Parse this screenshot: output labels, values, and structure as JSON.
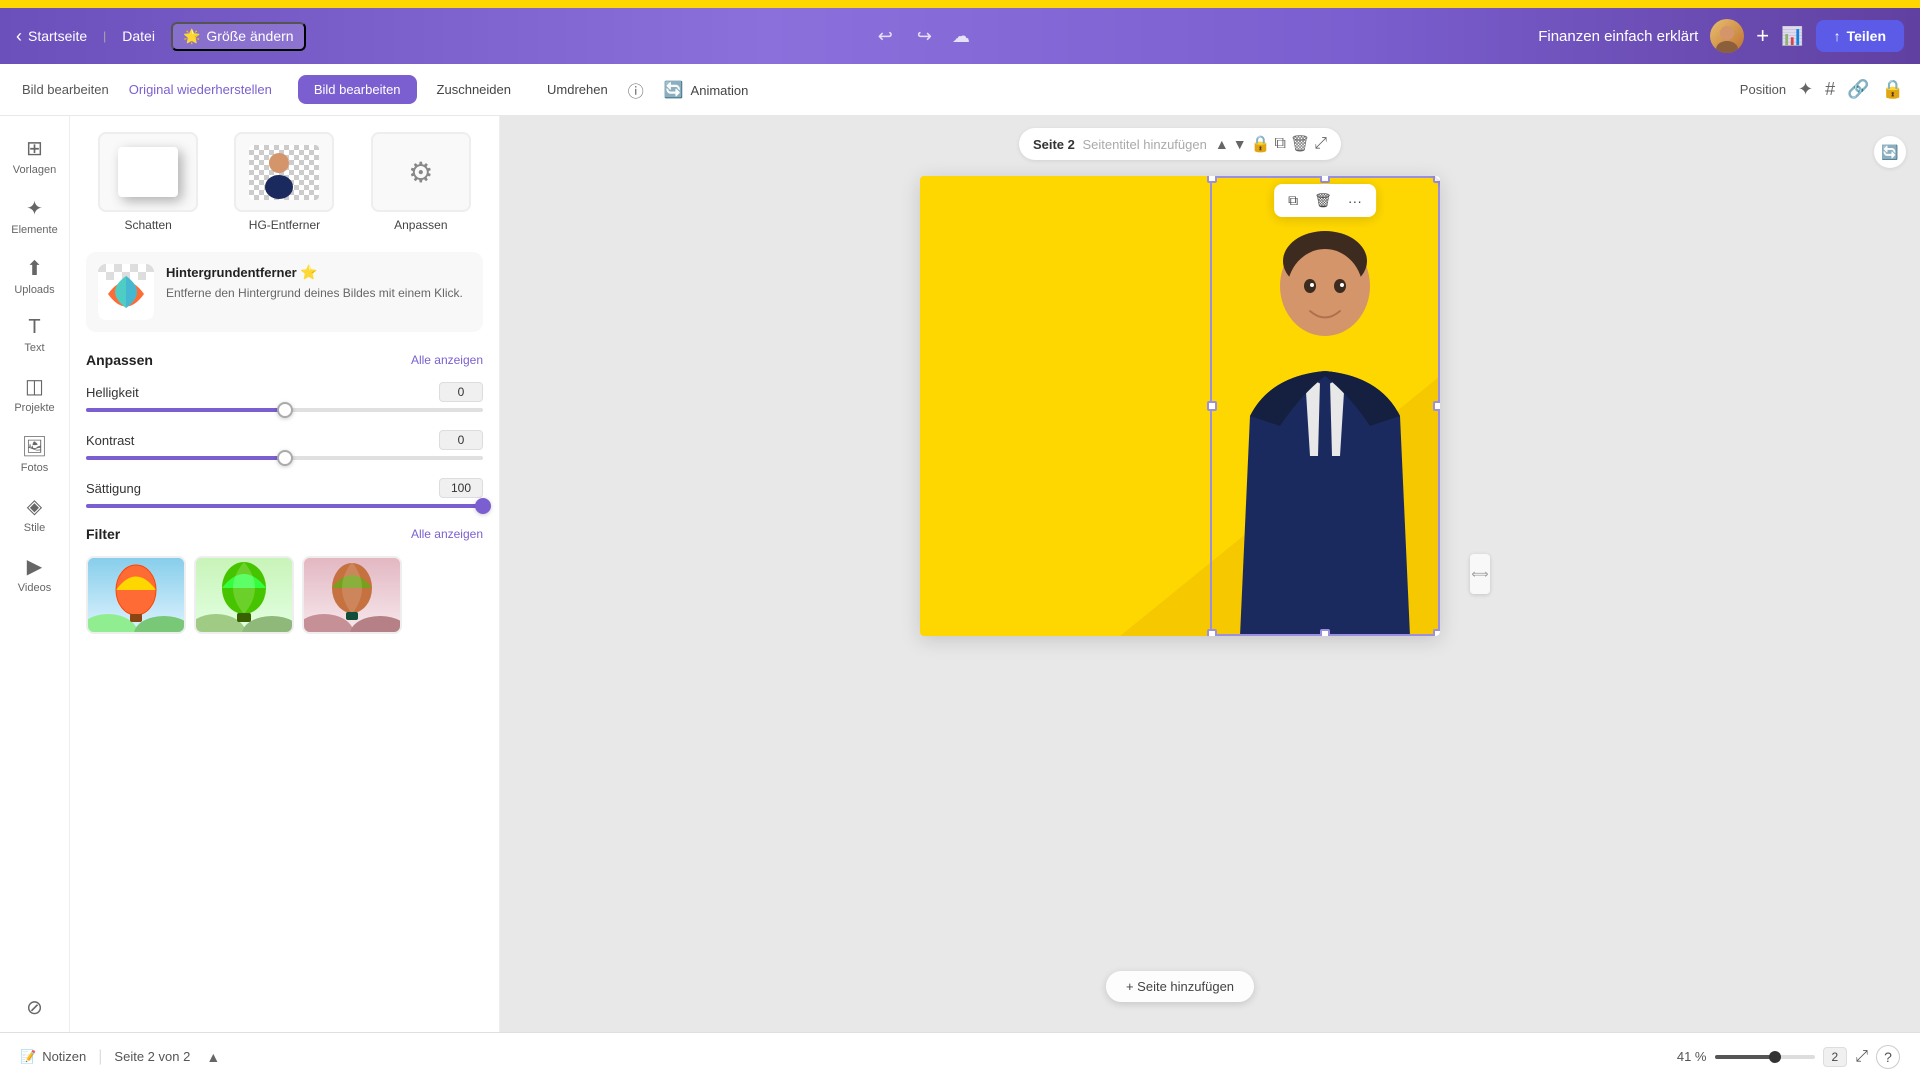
{
  "topBar": {
    "color": "#FFD700"
  },
  "header": {
    "backLabel": "Startseite",
    "fileLabel": "Datei",
    "resizeLabel": "Größe ändern",
    "resizeIcon": "🌟",
    "projectTitle": "Finanzen einfach erklärt",
    "shareLabel": "Teilen",
    "shareIcon": "↑"
  },
  "toolbar2": {
    "editImageLabel": "Bild bearbeiten",
    "restoreLabel": "Original wiederherstellen",
    "tabs": [
      {
        "label": "Bild bearbeiten",
        "active": true
      },
      {
        "label": "Zuschneiden",
        "active": false
      },
      {
        "label": "Umdrehen",
        "active": false
      }
    ],
    "animationLabel": "Animation",
    "positionLabel": "Position"
  },
  "sidebar": {
    "items": [
      {
        "label": "Vorlagen",
        "icon": "⊞"
      },
      {
        "label": "Elemente",
        "icon": "✦"
      },
      {
        "label": "Uploads",
        "icon": "⬆"
      },
      {
        "label": "Text",
        "icon": "T"
      },
      {
        "label": "Projekte",
        "icon": "◫"
      },
      {
        "label": "Fotos",
        "icon": "🖼"
      },
      {
        "label": "Stile",
        "icon": "◈"
      },
      {
        "label": "Videos",
        "icon": "▶"
      },
      {
        "label": "",
        "icon": "⊘"
      }
    ]
  },
  "leftPanel": {
    "imageOptions": [
      {
        "label": "Schatten",
        "type": "shadow"
      },
      {
        "label": "HG-Entferner",
        "type": "bg-remove"
      },
      {
        "label": "Anpassen",
        "type": "adjust"
      }
    ],
    "bgRemover": {
      "title": "Hintergrundentferner",
      "description": "Entferne den Hintergrund deines Bildes mit einem Klick.",
      "premiumIcon": "⭐"
    },
    "adjust": {
      "title": "Anpassen",
      "showAllLabel": "Alle anzeigen",
      "sliders": [
        {
          "label": "Helligkeit",
          "value": "0",
          "percent": 50
        },
        {
          "label": "Kontrast",
          "value": "0",
          "percent": 50
        },
        {
          "label": "Sättigung",
          "value": "100",
          "percent": 100
        }
      ]
    },
    "filter": {
      "title": "Filter",
      "showAllLabel": "Alle anzeigen"
    }
  },
  "canvas": {
    "pageTitleLabel": "Seite 2",
    "pageTitlePlaceholder": "Seitentitel hinzufügen",
    "addPageLabel": "+ Seite hinzufügen",
    "floatingToolbar": {
      "copyIcon": "⧉",
      "deleteIcon": "🗑",
      "moreIcon": "···"
    }
  },
  "bottomBar": {
    "notesLabel": "Notizen",
    "pageCountLabel": "Seite 2 von 2",
    "zoomLevel": "41 %",
    "pageNum": "2",
    "expandIcon": "⤢",
    "helpIcon": "?"
  }
}
